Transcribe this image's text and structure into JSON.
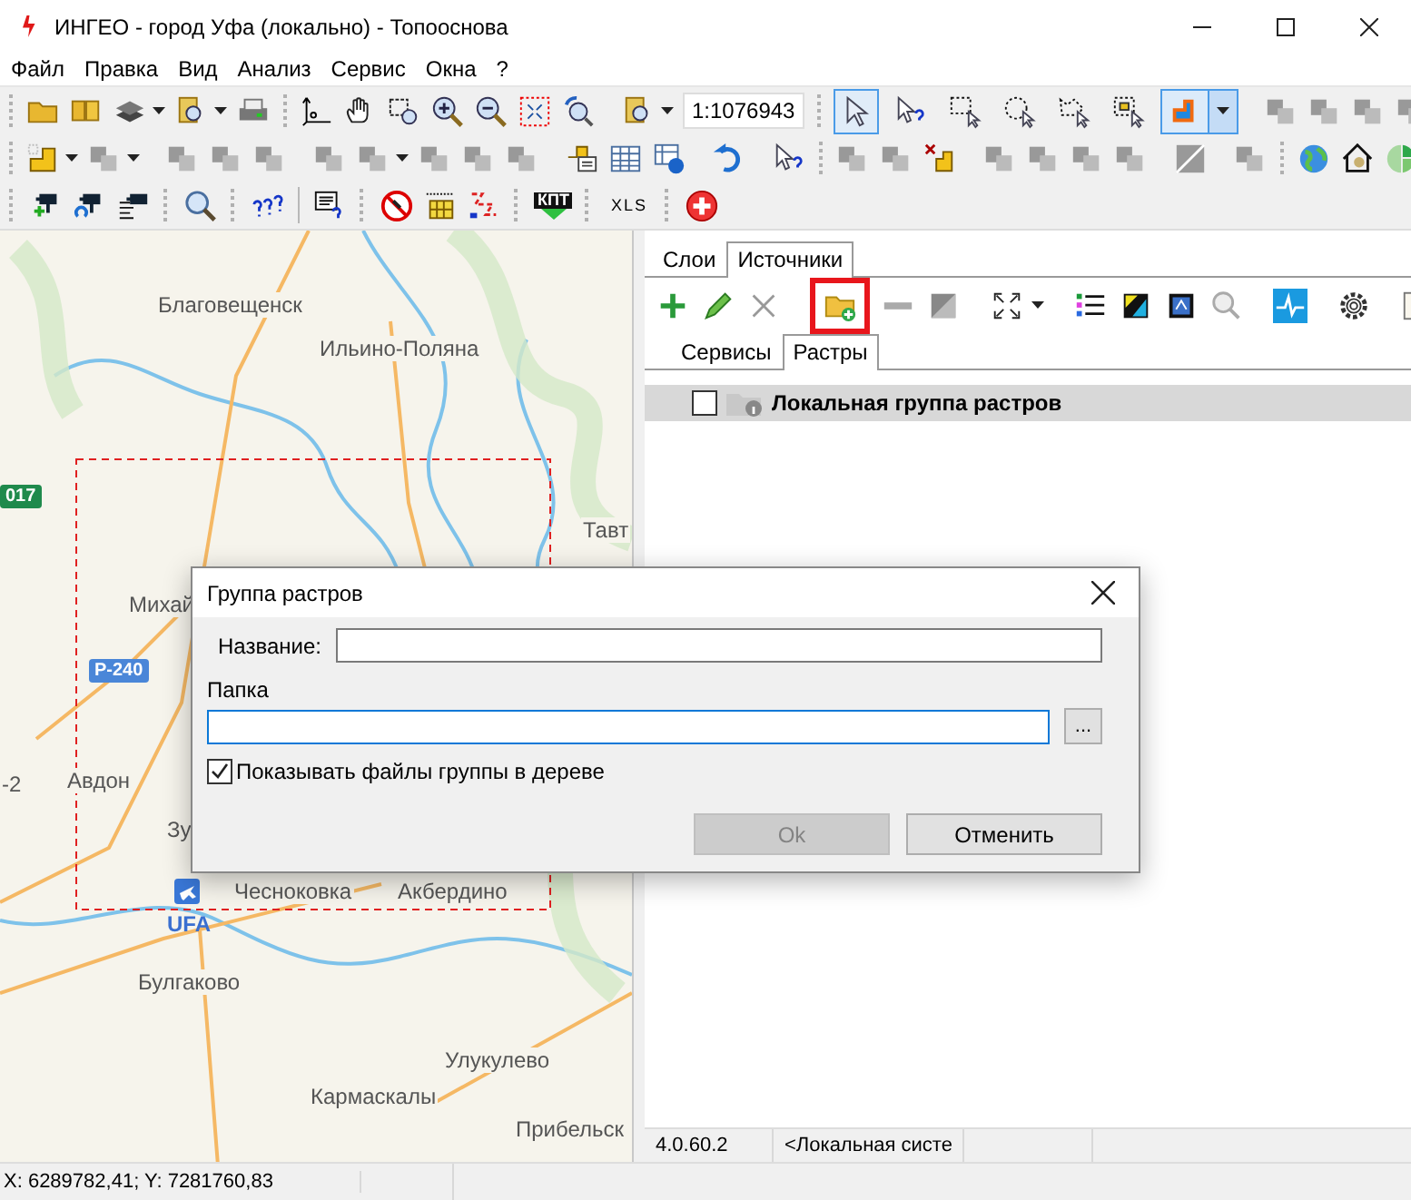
{
  "window": {
    "title": "ИНГЕО - город Уфа (локально) - Топооснова"
  },
  "menu": [
    "Файл",
    "Правка",
    "Вид",
    "Анализ",
    "Сервис",
    "Окна",
    "?"
  ],
  "toolbar": {
    "scale": "1:1076943",
    "selection_tools": [
      {
        "selected": true
      },
      {
        "selected": false
      },
      {
        "selected": false
      },
      {
        "selected": false
      },
      {
        "selected": false
      },
      {
        "selected": false
      }
    ],
    "style_button": {
      "selected": true
    },
    "kpt_label": "КПТ",
    "xls_label": "XLS"
  },
  "map": {
    "labels": [
      {
        "text": "Благовещенск",
        "kind": "town"
      },
      {
        "text": "Ильино-Поляна",
        "kind": "town"
      },
      {
        "text": "017",
        "kind": "road",
        "color": "#1f8a4c"
      },
      {
        "text": "Тавт",
        "kind": "town"
      },
      {
        "text": "Михай",
        "kind": "town"
      },
      {
        "text": "Р-240",
        "kind": "road",
        "color": "#4a86d8"
      },
      {
        "text": "-2",
        "kind": "town"
      },
      {
        "text": "Авдон",
        "kind": "town"
      },
      {
        "text": "Зу",
        "kind": "town"
      },
      {
        "text": "Чесноковка",
        "kind": "town"
      },
      {
        "text": "Акбердино",
        "kind": "town"
      },
      {
        "text": "UFA",
        "kind": "airport"
      },
      {
        "text": "Булгаково",
        "kind": "town"
      },
      {
        "text": "Улукулево",
        "kind": "town"
      },
      {
        "text": "Кармаскалы",
        "kind": "town"
      },
      {
        "text": "Прибельск",
        "kind": "town"
      }
    ]
  },
  "panel": {
    "tabs": [
      {
        "label": "Слои",
        "selected": false
      },
      {
        "label": "Источники",
        "selected": true
      }
    ],
    "add_group_highlighted": true,
    "subtabs": [
      {
        "label": "Сервисы",
        "selected": false
      },
      {
        "label": "Растры",
        "selected": true
      }
    ],
    "tree": [
      {
        "label": "Локальная группа растров",
        "checked": false,
        "selected": true
      }
    ],
    "status": [
      "4.0.60.2",
      "<Локальная систе"
    ]
  },
  "dialog": {
    "title": "Группа растров",
    "name_label": "Название:",
    "folder_label": "Папка",
    "folder_focused": true,
    "browse": "...",
    "show_files": {
      "label": "Показывать файлы группы в дереве",
      "checked": true
    },
    "buttons": [
      {
        "label": "Ok",
        "disabled": true
      },
      {
        "label": "Отменить",
        "disabled": false
      }
    ]
  },
  "status_bar": {
    "coordinates": "X: 6289782,41; Y: 7281760,83"
  }
}
